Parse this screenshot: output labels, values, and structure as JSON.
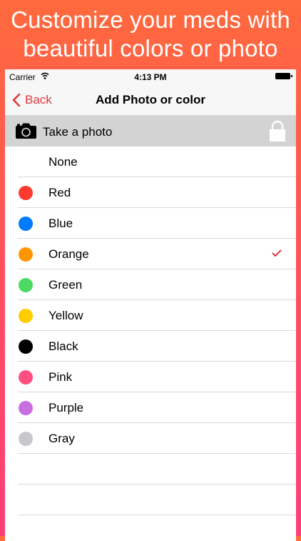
{
  "headline": {
    "line1": "Customize your meds with",
    "line2": "beautiful colors or photo"
  },
  "statusbar": {
    "carrier": "Carrier",
    "time": "4:13 PM"
  },
  "navbar": {
    "back_label": "Back",
    "title": "Add Photo or color"
  },
  "photo_row": {
    "label": "Take a photo",
    "icon": "camera-icon",
    "lock_icon": "lock-icon"
  },
  "colors": [
    {
      "label": "None",
      "swatch": ""
    },
    {
      "label": "Red",
      "swatch": "#ff3b30"
    },
    {
      "label": "Blue",
      "swatch": "#007aff"
    },
    {
      "label": "Orange",
      "swatch": "#ff9500"
    },
    {
      "label": "Green",
      "swatch": "#4cd964"
    },
    {
      "label": "Yellow",
      "swatch": "#ffcc00"
    },
    {
      "label": "Black",
      "swatch": "#000000"
    },
    {
      "label": "Pink",
      "swatch": "#ff4f80"
    },
    {
      "label": "Purple",
      "swatch": "#c86ee0"
    },
    {
      "label": "Gray",
      "swatch": "#c7c7cc"
    }
  ],
  "selected_color": "Orange",
  "accent_color": "#e0393e"
}
